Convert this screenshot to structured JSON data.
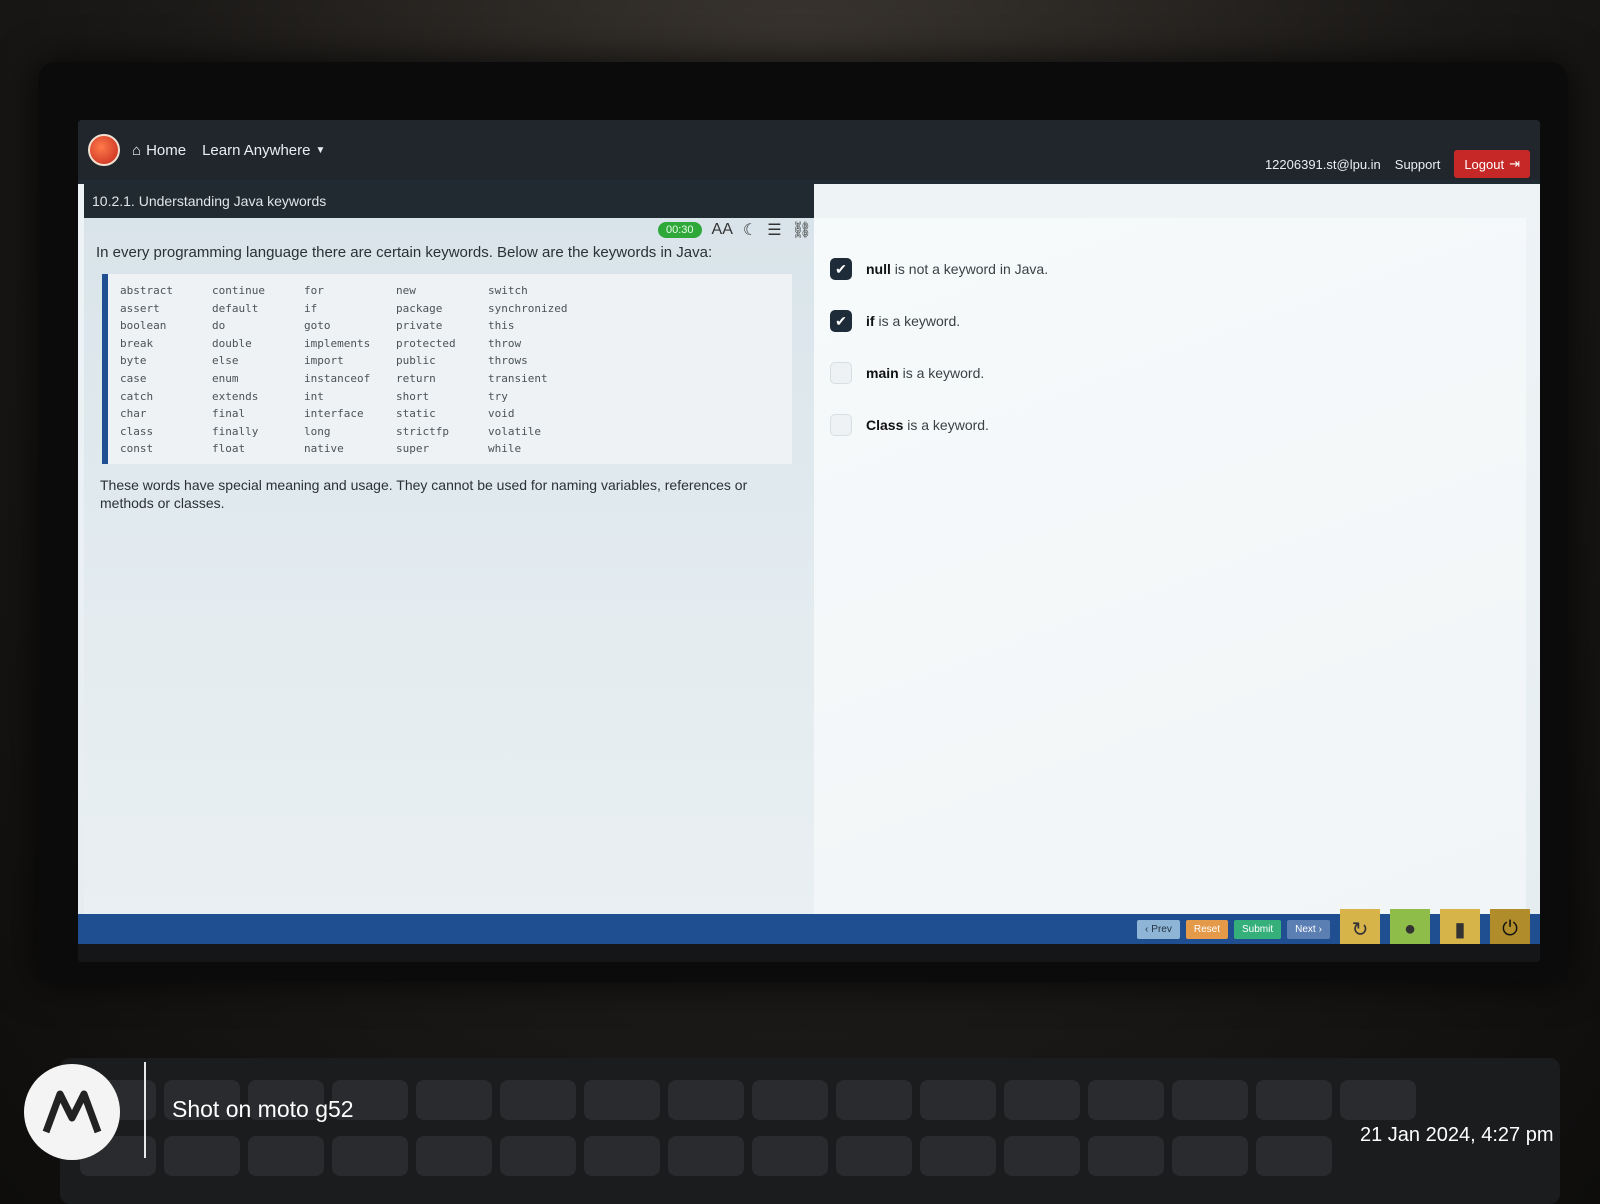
{
  "nav": {
    "home_label": "Home",
    "learn_label": "Learn Anywhere",
    "user_email": "12206391.st@lpu.in",
    "support_label": "Support",
    "logout_label": "Logout"
  },
  "lesson": {
    "title": "10.2.1. Understanding Java keywords",
    "timer": "00:30",
    "font_tool_label": "AA",
    "intro": "In every programming language there are certain keywords. Below are the keywords in Java:",
    "keyword_columns": [
      [
        "abstract",
        "assert",
        "boolean",
        "break",
        "byte",
        "case",
        "catch",
        "char",
        "class",
        "const"
      ],
      [
        "continue",
        "default",
        "do",
        "double",
        "else",
        "enum",
        "extends",
        "final",
        "finally",
        "float"
      ],
      [
        "for",
        "if",
        "goto",
        "implements",
        "import",
        "instanceof",
        "int",
        "interface",
        "long",
        "native"
      ],
      [
        "new",
        "package",
        "private",
        "protected",
        "public",
        "return",
        "short",
        "static",
        "strictfp",
        "super"
      ],
      [
        "switch",
        "synchronized",
        "this",
        "throw",
        "throws",
        "transient",
        "try",
        "void",
        "volatile",
        "while"
      ]
    ],
    "outro": "These words have special meaning and usage. They cannot be used for naming variables, references or methods or classes."
  },
  "question": {
    "options": [
      {
        "keyword": "null",
        "text": "is not a keyword in Java.",
        "checked": true
      },
      {
        "keyword": "if",
        "text": "is a keyword.",
        "checked": true
      },
      {
        "keyword": "main",
        "text": "is a keyword.",
        "checked": false
      },
      {
        "keyword": "Class",
        "text": "is a keyword.",
        "checked": false
      }
    ]
  },
  "footer": {
    "prev_label": "Prev",
    "reset_label": "Reset",
    "submit_label": "Submit",
    "next_label": "Next"
  },
  "watermark": {
    "shot_on": "Shot on moto g52",
    "datetime": "21 Jan 2024, 4:27 pm"
  },
  "colors": {
    "accent_blue": "#1f4f91",
    "logout_red": "#c62828",
    "timer_green": "#2fa83a",
    "submit_green": "#35b07b",
    "reset_orange": "#e59a4a"
  }
}
